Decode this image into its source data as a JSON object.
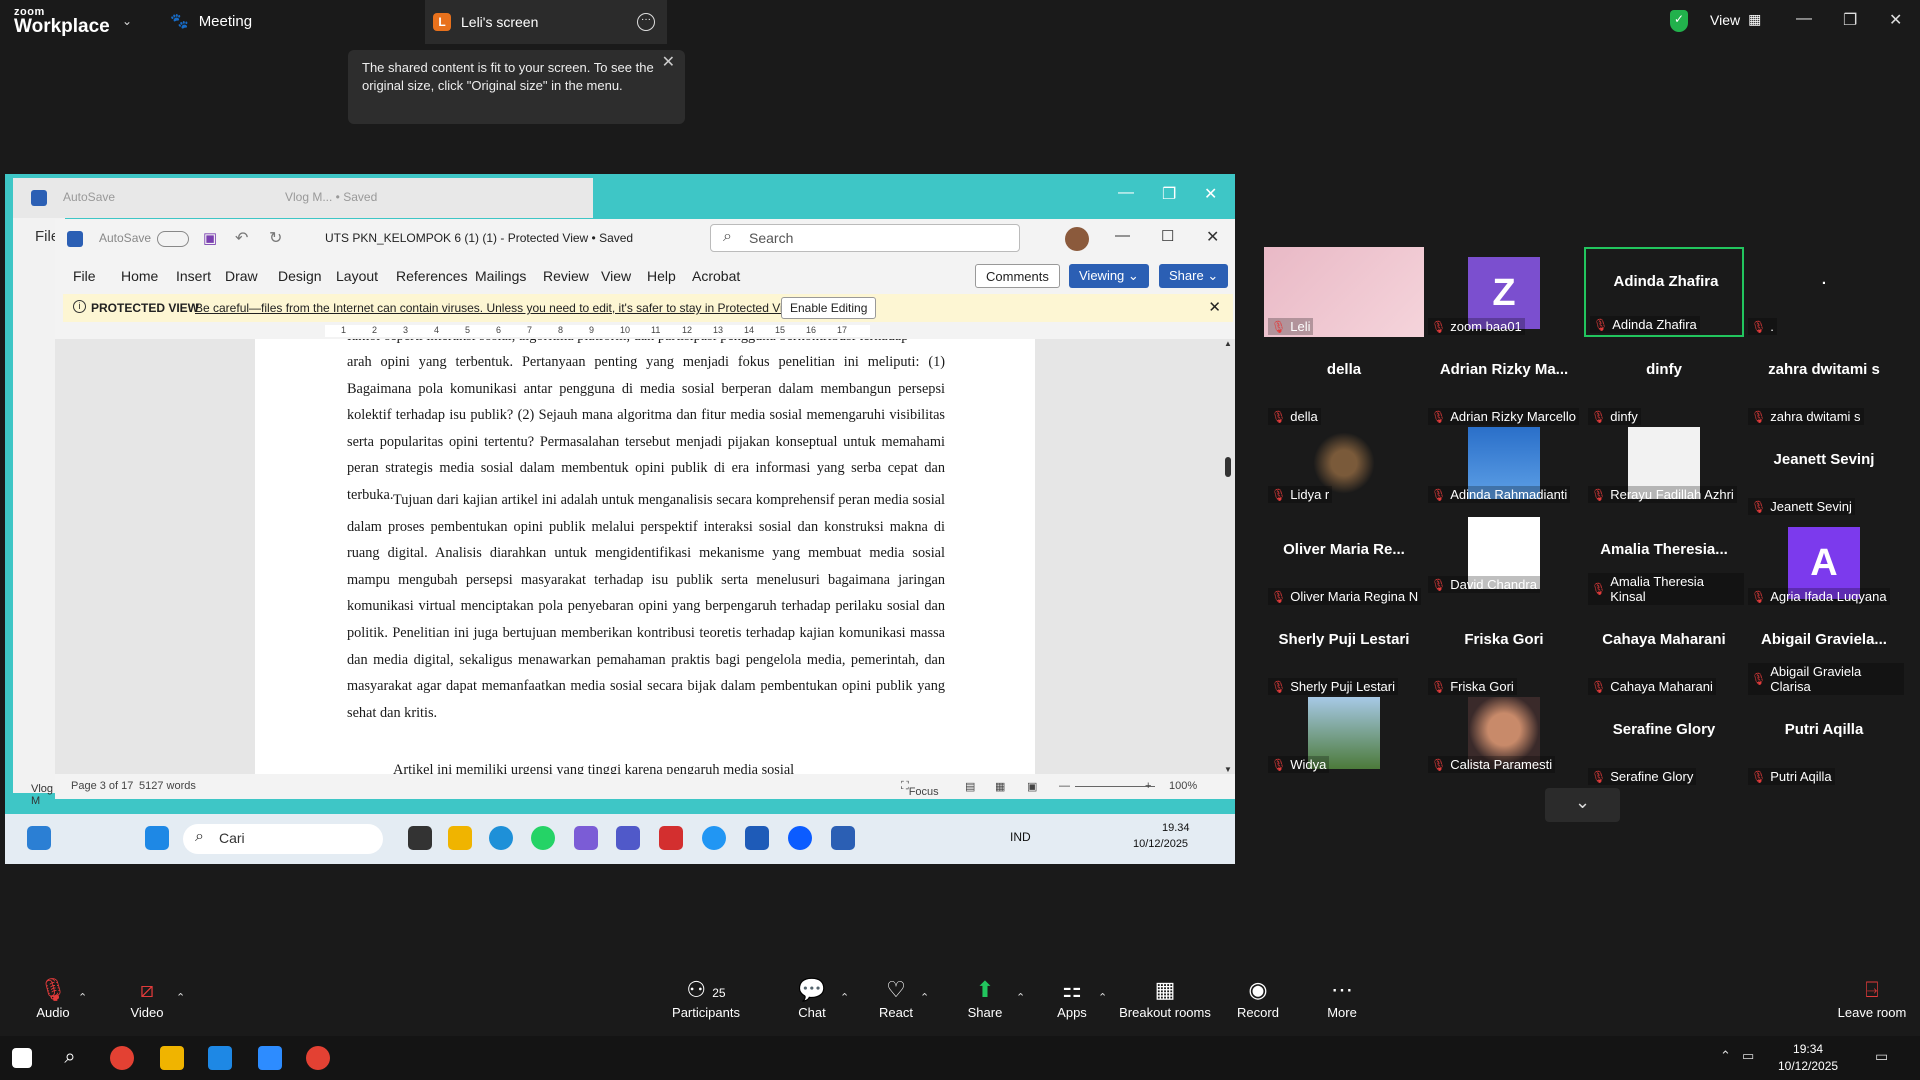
{
  "zoom": {
    "brand_top": "zoom",
    "brand_bottom": "Workplace",
    "meeting_tab": "Meeting",
    "screen_tab": "Leli's screen",
    "screen_badge": "L",
    "view_label": "View",
    "tooltip": "The shared content is fit to your screen. To see the original size, click \"Original size\" in the menu."
  },
  "bg_window": {
    "autosave": "AutoSave",
    "title": "Vlog M... • Saved",
    "file": "File",
    "vlog": "Vlog M"
  },
  "word": {
    "autosave": "AutoSave",
    "title": "UTS PKN_KELOMPOK 6 (1) (1)  -  Protected View • Saved",
    "search_placeholder": "Search",
    "menu": [
      "File",
      "Home",
      "Insert",
      "Draw",
      "Design",
      "Layout",
      "References",
      "Mailings",
      "Review",
      "View",
      "Help",
      "Acrobat"
    ],
    "comments": "Comments",
    "viewing": "Viewing",
    "share": "Share",
    "protected_label": "PROTECTED VIEW",
    "protected_msg": "Be careful—files from the Internet can contain viruses. Unless you need to edit, it's safer to stay in Protected View.",
    "enable_editing": "Enable Editing",
    "ruler_numbers": [
      "1",
      "2",
      "3",
      "4",
      "5",
      "6",
      "7",
      "8",
      "9",
      "10",
      "11",
      "12",
      "13",
      "14",
      "15",
      "16",
      "17"
    ],
    "para_top_cut": "faktor seperti interaksi sosial, algoritma platform, dan partisipasi pengguna berkontribusi terhadap",
    "para1": "arah opini yang terbentuk. Pertanyaan penting yang menjadi fokus penelitian ini meliputi: (1) Bagaimana pola komunikasi antar pengguna di media sosial berperan dalam membangun persepsi kolektif terhadap isu publik? (2) Sejauh mana algoritma dan fitur media sosial memengaruhi visibilitas serta popularitas opini tertentu? Permasalahan tersebut menjadi pijakan konseptual untuk memahami peran strategis media sosial dalam membentuk opini publik di era informasi yang serba cepat dan terbuka.",
    "para2": "Tujuan dari kajian artikel ini adalah untuk menganalisis secara komprehensif peran media sosial dalam proses pembentukan opini publik melalui perspektif interaksi sosial dan konstruksi makna di ruang digital. Analisis diarahkan untuk mengidentifikasi mekanisme yang membuat media sosial mampu mengubah persepsi masyarakat terhadap isu publik serta menelusuri bagaimana jaringan komunikasi virtual menciptakan pola penyebaran opini yang berpengaruh terhadap perilaku sosial dan politik. Penelitian ini juga bertujuan memberikan kontribusi teoretis terhadap kajian komunikasi massa dan media digital, sekaligus menawarkan pemahaman praktis bagi pengelola media, pemerintah, dan masyarakat agar dapat memanfaatkan media sosial secara bijak dalam pembentukan opini publik yang sehat dan kritis.",
    "para_bottom_cut": "Artikel ini memiliki urgensi yang tinggi karena pengaruh media sosial",
    "page_info": "Page 3 of 17",
    "words": "5127 words",
    "focus": "Focus",
    "zoom_level": "100%"
  },
  "inner_taskbar": {
    "search": "Cari",
    "lang": "IND",
    "time": "19.34",
    "date": "10/12/2025"
  },
  "participants": [
    {
      "display": "",
      "label": "Leli",
      "kind": "video-leli"
    },
    {
      "display": "Z",
      "label": "zoom baa01",
      "kind": "avatar-z"
    },
    {
      "display": "Adinda Zhafira",
      "label": "Adinda Zhafira",
      "kind": "active"
    },
    {
      "display": ".",
      "label": ".",
      "kind": "name"
    },
    {
      "display": "della",
      "label": "della",
      "kind": "name"
    },
    {
      "display": "Adrian Rizky Ma...",
      "label": "Adrian Rizky Marcello",
      "kind": "name"
    },
    {
      "display": "dinfy",
      "label": "dinfy",
      "kind": "name"
    },
    {
      "display": "zahra dwitami s",
      "label": "zahra dwitami s",
      "kind": "name"
    },
    {
      "display": "",
      "label": "Lidya r",
      "kind": "photo-cat"
    },
    {
      "display": "",
      "label": "Adinda Rahmadianti",
      "kind": "photo-sky"
    },
    {
      "display": "",
      "label": "Rerayu Fadillah Azhri",
      "kind": "photo-white"
    },
    {
      "display": "Jeanett Sevinj",
      "label": "Jeanett Sevinj",
      "kind": "name"
    },
    {
      "display": "Oliver Maria Re...",
      "label": "Oliver Maria Regina N",
      "kind": "name"
    },
    {
      "display": "",
      "label": "David Chandra",
      "kind": "photo-uni"
    },
    {
      "display": "Amalia Theresia...",
      "label": "Amalia Theresia Kinsal",
      "kind": "name"
    },
    {
      "display": "A",
      "label": "Agria Ifada Luqyana",
      "kind": "avatar-a"
    },
    {
      "display": "Sherly Puji Lestari",
      "label": "Sherly Puji Lestari",
      "kind": "name"
    },
    {
      "display": "Friska Gori",
      "label": "Friska Gori",
      "kind": "name"
    },
    {
      "display": "Cahaya Maharani",
      "label": "Cahaya Maharani",
      "kind": "name"
    },
    {
      "display": "Abigail Graviela...",
      "label": "Abigail Graviela Clarisa",
      "kind": "name"
    },
    {
      "display": "",
      "label": "Widya",
      "kind": "photo-hills"
    },
    {
      "display": "",
      "label": "Calista Paramesti",
      "kind": "photo-face"
    },
    {
      "display": "Serafine Glory",
      "label": "Serafine Glory",
      "kind": "name"
    },
    {
      "display": "Putri Aqilla",
      "label": "Putri Aqilla",
      "kind": "name"
    }
  ],
  "controls": {
    "audio": "Audio",
    "video": "Video",
    "participants": "Participants",
    "participants_count": "25",
    "chat": "Chat",
    "react": "React",
    "share": "Share",
    "apps": "Apps",
    "breakout": "Breakout rooms",
    "record": "Record",
    "more": "More",
    "leave": "Leave room"
  },
  "win_taskbar": {
    "time": "19:34",
    "date": "10/12/2025"
  },
  "colors": {
    "active_border": "#22c55e",
    "share_green": "#22c55e",
    "muted_red": "#e23b3b",
    "word_blue": "#2b5fb4"
  }
}
